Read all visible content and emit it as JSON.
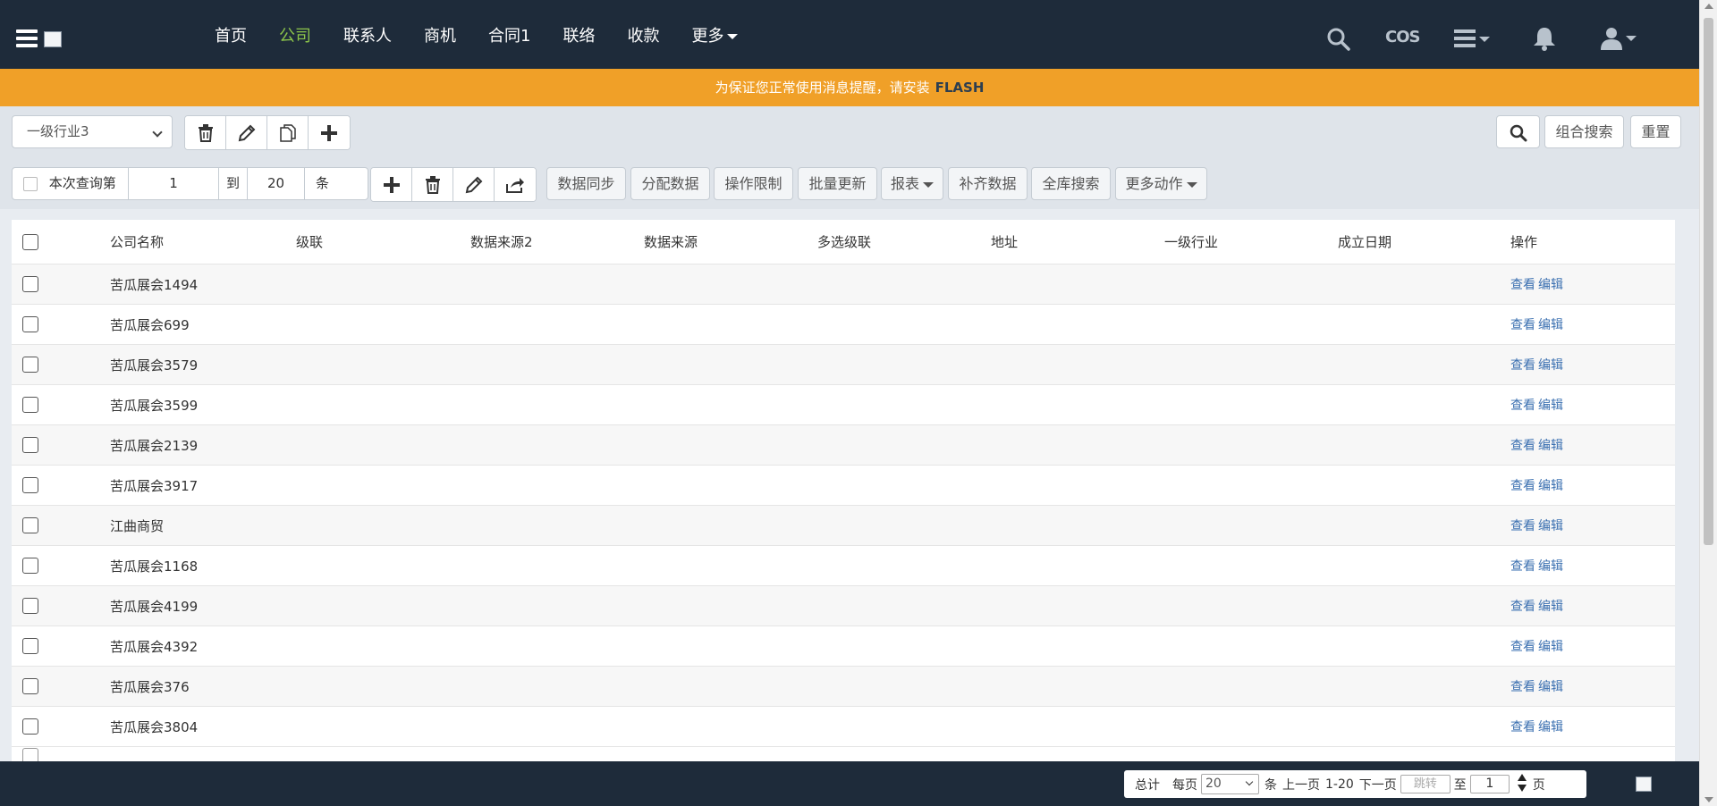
{
  "nav": {
    "items": [
      {
        "label": "首页",
        "active": false
      },
      {
        "label": "公司",
        "active": true
      },
      {
        "label": "联系人",
        "active": false
      },
      {
        "label": "商机",
        "active": false
      },
      {
        "label": "合同1",
        "active": false
      },
      {
        "label": "联络",
        "active": false
      },
      {
        "label": "收款",
        "active": false
      },
      {
        "label": "更多",
        "active": false
      }
    ],
    "cos_label": "COS",
    "icons": [
      "search-icon",
      "cos-icon",
      "list-menu-icon",
      "bell-icon",
      "user-icon"
    ]
  },
  "banner": {
    "text": "为保证您正常使用消息提醒，请安装",
    "highlight": "FLASH"
  },
  "toolbar": {
    "filter_select": "一级行业3",
    "combo_search": "组合搜索",
    "reset": "重置"
  },
  "range": {
    "label": "本次查询第",
    "from": "1",
    "to_label": "到",
    "to": "20",
    "unit": "条"
  },
  "actions": {
    "sync": "数据同步",
    "assign": "分配数据",
    "restrict": "操作限制",
    "batch_update": "批量更新",
    "report": "报表",
    "fill": "补齐数据",
    "global_search": "全库搜索",
    "more": "更多动作"
  },
  "table": {
    "headers": [
      "公司名称",
      "级联",
      "数据来源2",
      "数据来源",
      "多选级联",
      "地址",
      "一级行业",
      "成立日期",
      "操作"
    ],
    "view_label": "查看",
    "edit_label": "编辑",
    "rows": [
      "苦瓜展会1494",
      "苦瓜展会699",
      "苦瓜展会3579",
      "苦瓜展会3599",
      "苦瓜展会2139",
      "苦瓜展会3917",
      "江曲商贸",
      "苦瓜展会1168",
      "苦瓜展会4199",
      "苦瓜展会4392",
      "苦瓜展会376",
      "苦瓜展会3804"
    ]
  },
  "pager": {
    "total_label": "总计",
    "per_page_label": "每页",
    "per_page": "20",
    "unit": "条",
    "prev": "上一页",
    "range": "1-20",
    "next": "下一页",
    "jump_placeholder": "跳转",
    "to_label": "至",
    "page": "1",
    "page_label": "页"
  },
  "colors": {
    "nav_bg": "#1e2b3a",
    "active_nav": "#8bc34a",
    "banner_bg": "#f0a028",
    "link": "#3a6fb0"
  }
}
